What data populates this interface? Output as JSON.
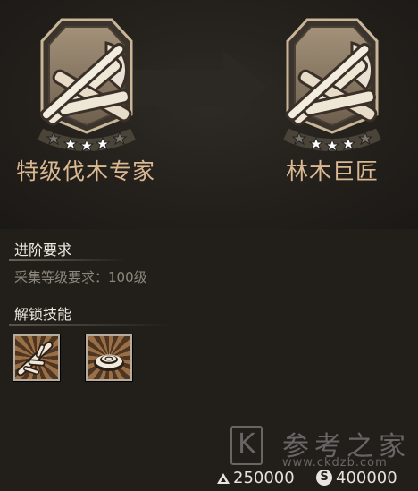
{
  "ranks": {
    "current": {
      "name": "特级伐木专家",
      "stars_filled": 3,
      "stars_total": 5
    },
    "next": {
      "name": "林木巨匠",
      "stars_filled": 3,
      "stars_total": 5
    }
  },
  "requirements": {
    "title": "进阶要求",
    "text": "采集等级要求：100级"
  },
  "unlock": {
    "title": "解锁技能",
    "skills": [
      {
        "icon": "branch-skill-icon"
      },
      {
        "icon": "stump-skill-icon"
      }
    ]
  },
  "watermark": {
    "letter": "K",
    "text": "参考之家",
    "url": "www.ckdzb.com"
  },
  "currency": [
    {
      "icon": "triangle-currency-icon",
      "amount": "250000"
    },
    {
      "icon": "s-coin-icon",
      "glyph": "S",
      "amount": "400000"
    }
  ]
}
